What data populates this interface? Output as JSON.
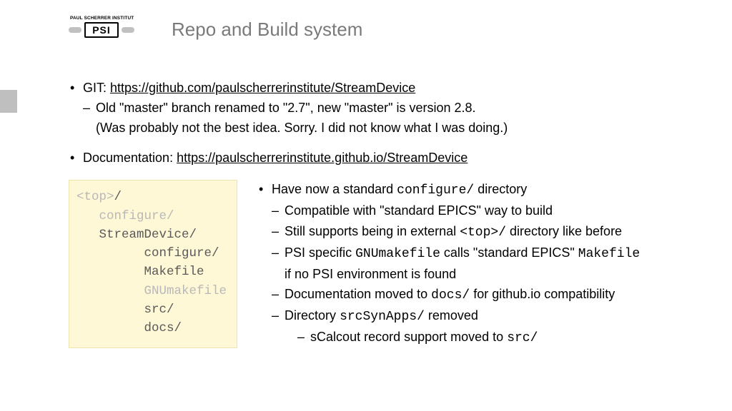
{
  "logo_text": "PAUL SCHERRER INSTITUT",
  "logo_abbrev": "PSI",
  "title": "Repo and Build system",
  "bullets": {
    "git_label": "GIT: ",
    "git_url": "https://github.com/paulscherrerinstitute/StreamDevice",
    "git_sub1": "Old \"master\" branch renamed to \"2.7\", new \"master\" is version 2.8.",
    "git_sub2": "(Was probably not the best idea. Sorry. I did not know what I was doing.)",
    "doc_label": "Documentation: ",
    "doc_url": "https://paulscherrerinstitute.github.io/StreamDevice"
  },
  "code": {
    "l1a": "<top>",
    "l1b": "/",
    "l2": "   configure/",
    "l3": "   StreamDevice/",
    "l4": "         configure/",
    "l5": "         Makefile",
    "l6": "         GNUmakefile",
    "l7": "         src/",
    "l8": "         docs/"
  },
  "right": {
    "b1a": "Have now a standard ",
    "b1b": "configure/",
    "b1c": " directory",
    "d1": "Compatible with \"standard EPICS\" way to build",
    "d2a": "Still supports being in external ",
    "d2b": "<top>/",
    "d2c": " directory like before",
    "d3a": "PSI specific ",
    "d3b": "GNUmakefile",
    "d3c": "  calls \"standard EPICS\" ",
    "d3d": "Makefile",
    "d3e": "if no PSI environment is found",
    "d4a": "Documentation moved to ",
    "d4b": "docs/",
    "d4c": " for github.io compatibility",
    "d5a": "Directory ",
    "d5b": "srcSynApps/",
    "d5c": " removed",
    "d6a": "sCalcout record support moved to ",
    "d6b": "src/"
  }
}
